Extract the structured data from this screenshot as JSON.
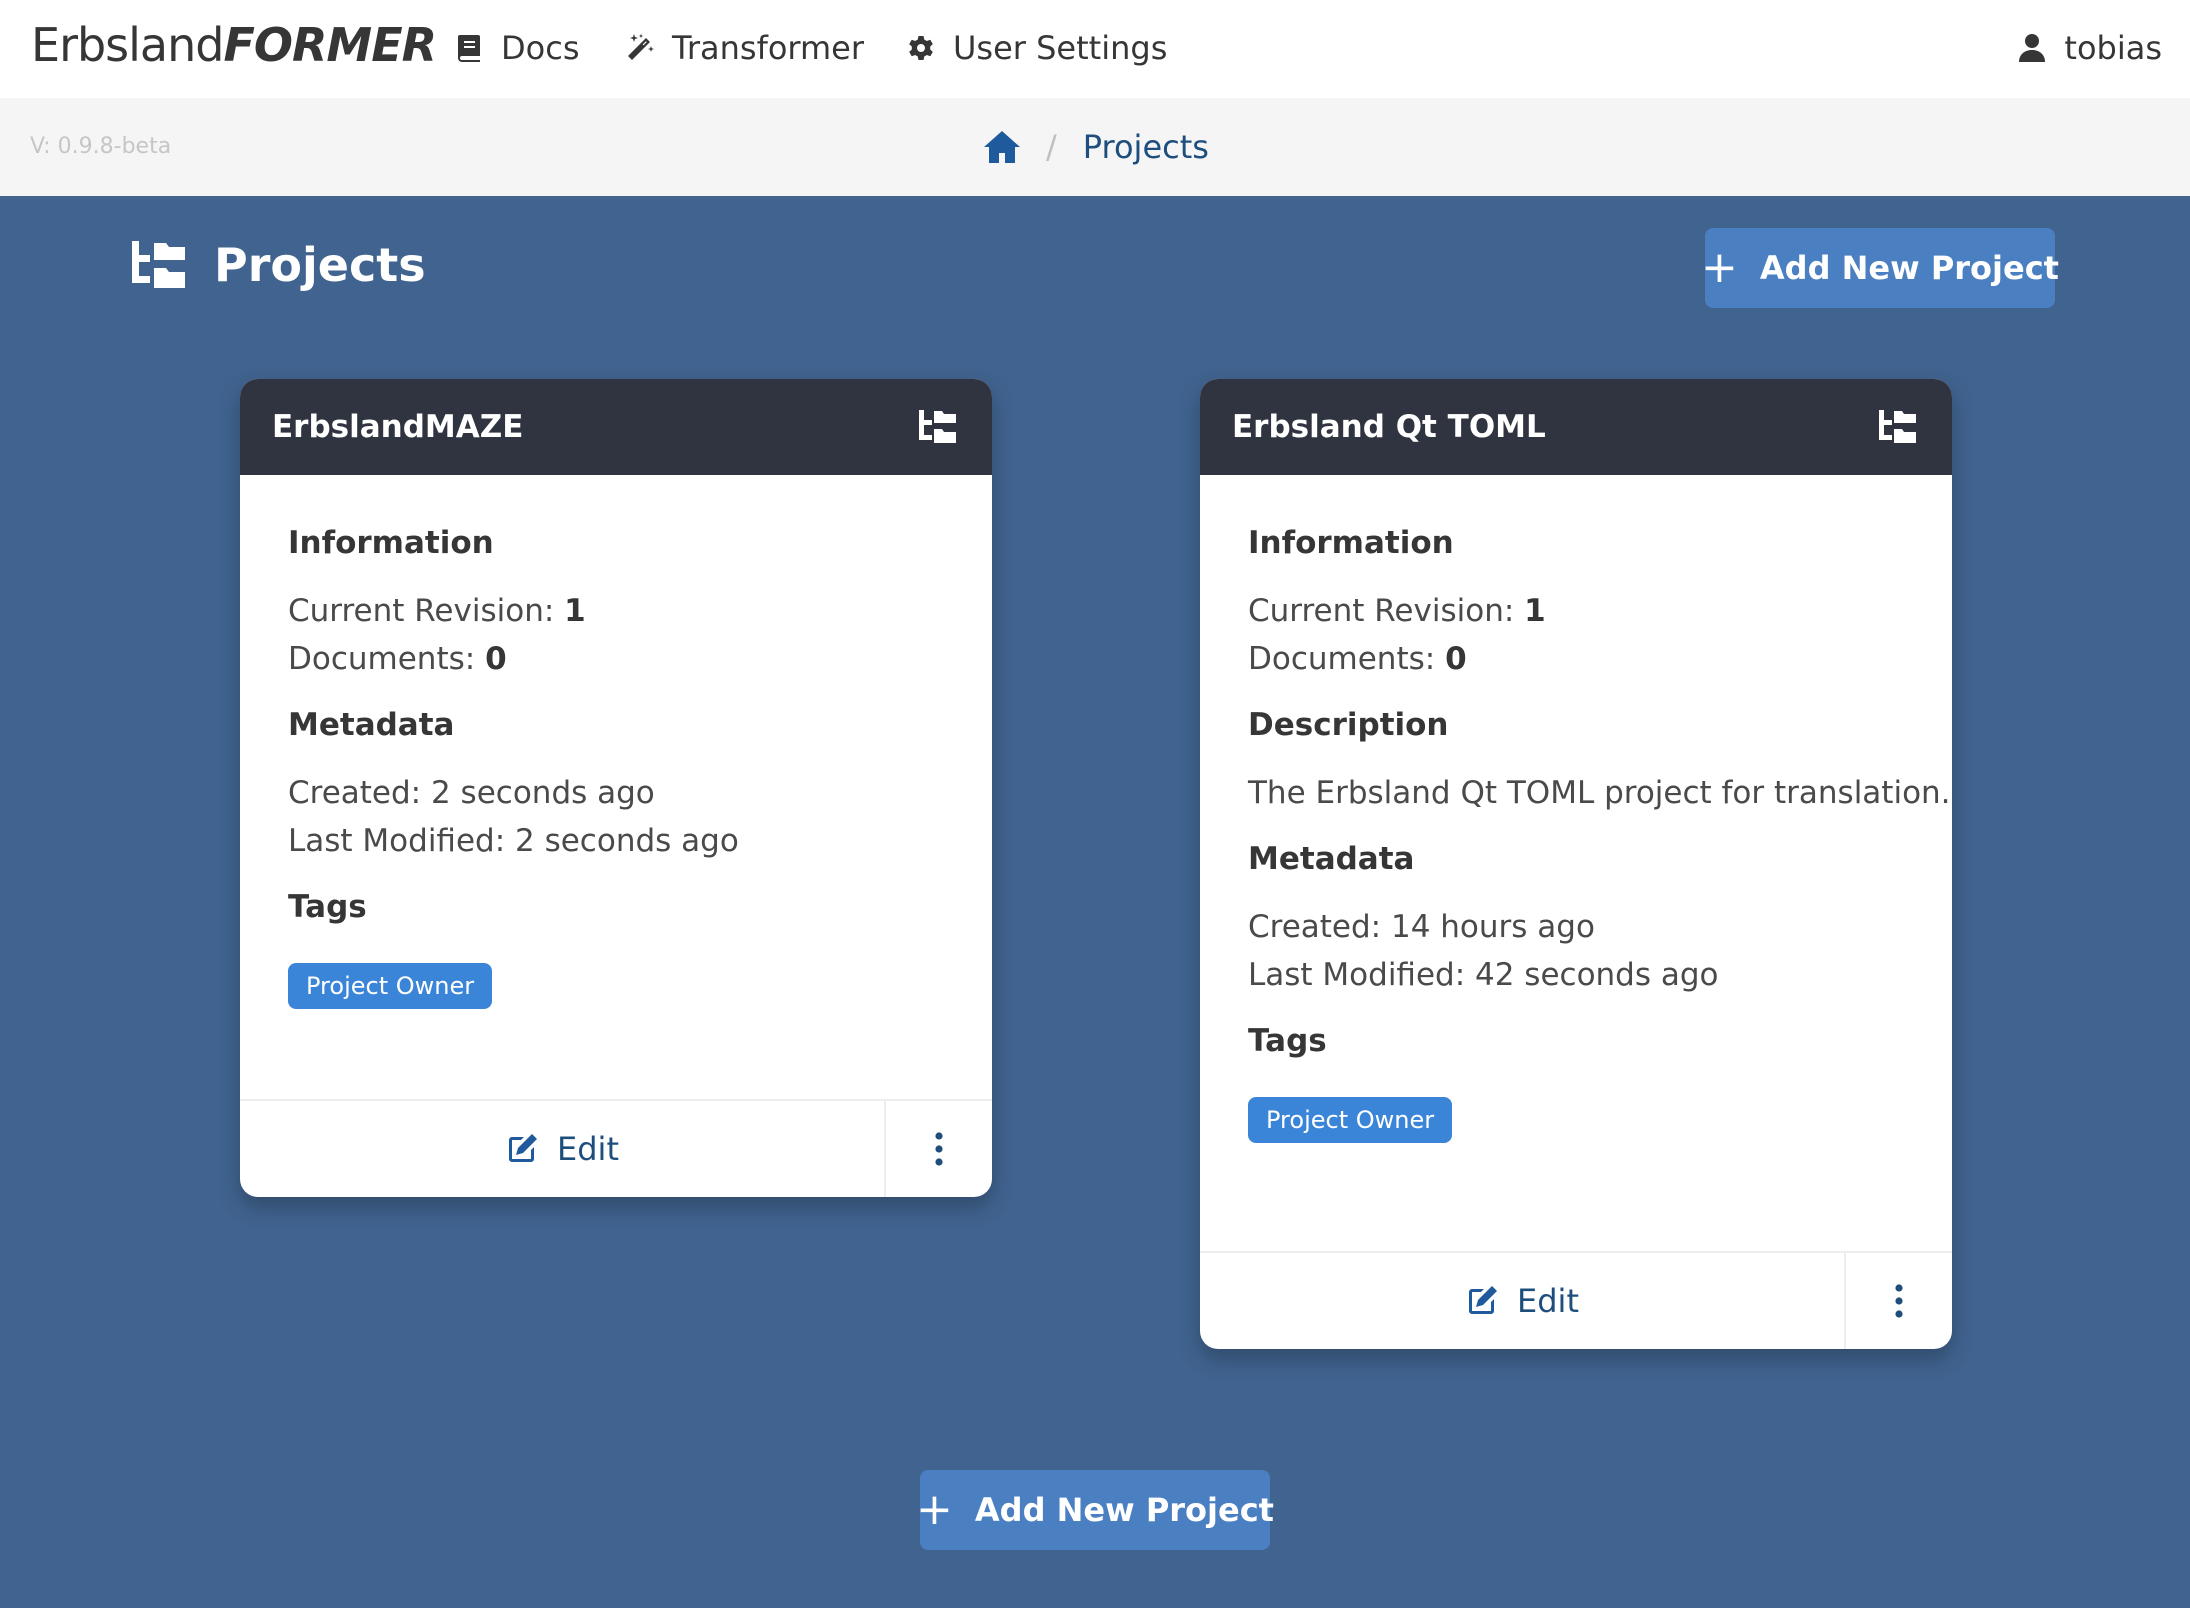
{
  "navbar": {
    "brand_prefix": "Erbsland",
    "brand_suffix": "FORMER",
    "items": [
      {
        "label": "Docs",
        "icon": "book-icon"
      },
      {
        "label": "Transformer",
        "icon": "magic-wand-icon"
      },
      {
        "label": "User Settings",
        "icon": "gear-icon"
      }
    ],
    "user": {
      "label": "tobias",
      "icon": "user-icon"
    }
  },
  "subbar": {
    "version": "V: 0.9.8-beta",
    "breadcrumb": {
      "home_icon": "home-icon",
      "separator": "/",
      "current": "Projects"
    }
  },
  "section": {
    "title": "Projects",
    "icon": "folder-tree-icon",
    "add_button_top": "Add New Project",
    "add_button_bottom": "Add New Project",
    "plus": "+"
  },
  "cards": [
    {
      "title": "ErbslandMAZE",
      "information_heading": "Information",
      "revision_label": "Current Revision:",
      "revision_value": "1",
      "documents_label": "Documents:",
      "documents_value": "0",
      "metadata_heading": "Metadata",
      "created": "Created: 2 seconds ago",
      "modified": "Last Modified: 2 seconds ago",
      "tags_heading": "Tags",
      "tag": "Project Owner",
      "edit_label": "Edit"
    },
    {
      "title": "Erbsland Qt TOML",
      "information_heading": "Information",
      "revision_label": "Current Revision:",
      "revision_value": "1",
      "documents_label": "Documents:",
      "documents_value": "0",
      "description_heading": "Description",
      "description": "The Erbsland Qt TOML project for translation.",
      "metadata_heading": "Metadata",
      "created": "Created: 14 hours ago",
      "modified": "Last Modified: 42 seconds ago",
      "tags_heading": "Tags",
      "tag": "Project Owner",
      "edit_label": "Edit"
    }
  ],
  "colors": {
    "background": "#40638f",
    "card_header": "#2f3440",
    "accent_button": "#4a7fc1",
    "tag": "#3b85d8",
    "link": "#1e4e7d"
  }
}
